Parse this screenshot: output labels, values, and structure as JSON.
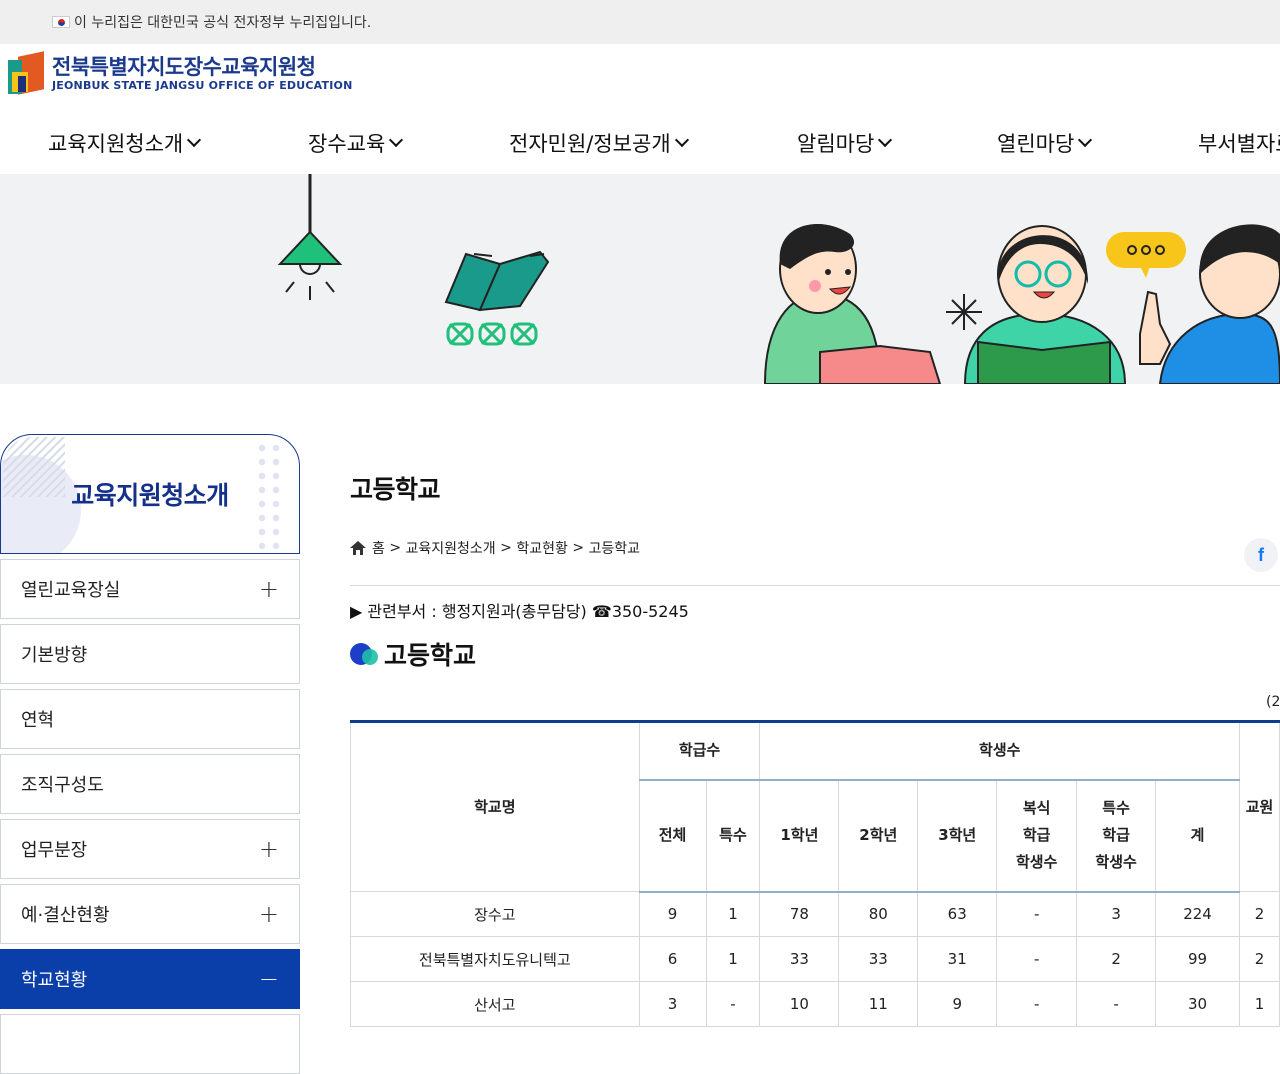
{
  "gov_banner": {
    "text": "이 누리집은 대한민국 공식 전자정부 누리집입니다."
  },
  "logo": {
    "name_ko": "전북특별자치도장수교육지원청",
    "name_en": "JEONBUK STATE JANGSU OFFICE OF EDUCATION"
  },
  "gnb": [
    "교육지원청소개",
    "장수교육",
    "전자민원/정보공개",
    "알림마당",
    "열린마당",
    "부서별자료"
  ],
  "lnb": {
    "title": "교육지원청소개",
    "items": [
      {
        "label": "열린교육장실",
        "toggle": "+"
      },
      {
        "label": "기본방향",
        "toggle": ""
      },
      {
        "label": "연혁",
        "toggle": ""
      },
      {
        "label": "조직구성도",
        "toggle": ""
      },
      {
        "label": "업무분장",
        "toggle": "+"
      },
      {
        "label": "예·결산현황",
        "toggle": "+"
      },
      {
        "label": "학교현황",
        "toggle": "−"
      }
    ]
  },
  "content": {
    "page_title": "고등학교",
    "breadcrumb": {
      "home": "홈",
      "sep": ">",
      "level1": "교육지원청소개",
      "level2": "학교현황",
      "level3": "고등학교"
    },
    "share_icon": "f",
    "department": "▶ 관련부서 : 행정지원과(총무담당) ☎350-5245",
    "section_title": "고등학교",
    "unit_label": "(2",
    "table": {
      "headers": {
        "school": "학교명",
        "classes": "학급수",
        "students": "학생수",
        "teachers": "교원",
        "total": "전체",
        "special": "특수",
        "grade1": "1학년",
        "grade2": "2학년",
        "grade3": "3학년",
        "multi": "복식 학급 학생수",
        "special_students": "특수 학급 학생수",
        "sum": "계"
      },
      "rows": [
        {
          "name": "장수고",
          "total": "9",
          "special": "1",
          "g1": "78",
          "g2": "80",
          "g3": "63",
          "multi": "-",
          "sp": "3",
          "sum": "224",
          "t": "2"
        },
        {
          "name": "전북특별자치도유니텍고",
          "total": "6",
          "special": "1",
          "g1": "33",
          "g2": "33",
          "g3": "31",
          "multi": "-",
          "sp": "2",
          "sum": "99",
          "t": "2"
        },
        {
          "name": "산서고",
          "total": "3",
          "special": "-",
          "g1": "10",
          "g2": "11",
          "g3": "9",
          "multi": "-",
          "sp": "-",
          "sum": "30",
          "t": "1"
        }
      ]
    }
  },
  "colors": {
    "primary": "#0a3faa",
    "table_top": "#0e3d8e",
    "banner_bg": "#f1f2f4"
  }
}
